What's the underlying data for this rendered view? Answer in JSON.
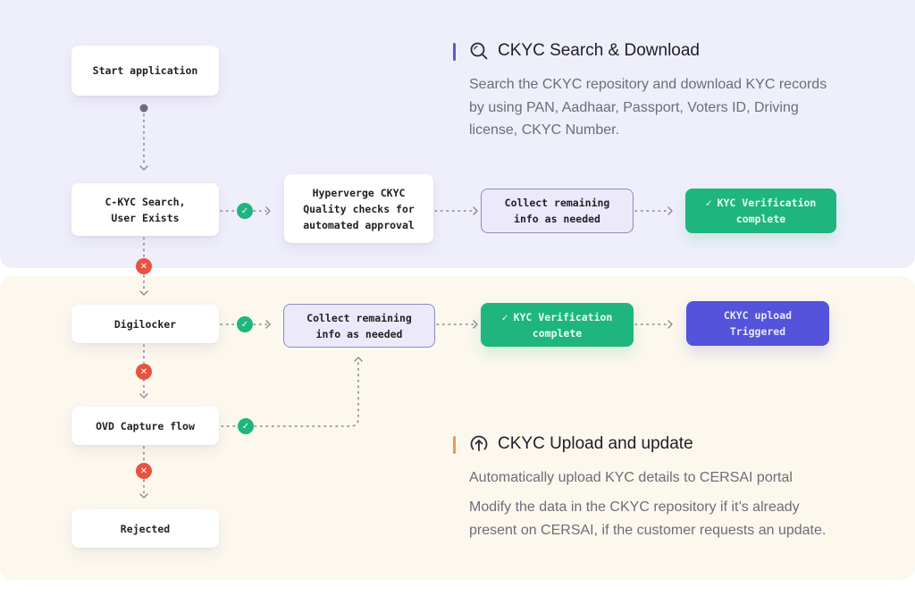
{
  "colors": {
    "top_panel": "#efeffb",
    "bottom_panel": "#fcf8ee",
    "success": "#1fb57f",
    "reject": "#e8533f",
    "triggered": "#5353dc",
    "collect_fill": "#ece9fb",
    "accent_search": "#5b5bc8",
    "accent_upload": "#e59a5c"
  },
  "search_section": {
    "icon": "search-icon",
    "title": "CKYC Search & Download",
    "description": "Search the CKYC repository and download KYC records by using PAN, Aadhaar,  Passport,  Voters ID, Driving license, CKYC Number."
  },
  "upload_section": {
    "icon": "upload-icon",
    "title": "CKYC Upload and update",
    "description_1": "Automatically upload KYC details to CERSAI portal",
    "description_2": "Modify the data in the CKYC repository if it’s already present on CERSAI, if the customer requests an update."
  },
  "flow": {
    "start": "Start application",
    "ckyc_search": [
      "C-KYC Search,",
      "User Exists"
    ],
    "hyperverge": [
      "Hyperverge CKYC",
      "Quality checks for",
      "automated approval"
    ],
    "collect_top": [
      "Collect remaining",
      "info as needed"
    ],
    "verified_top": [
      "KYC Verification",
      "complete"
    ],
    "digilocker": "Digilocker",
    "collect_bottom": [
      "Collect remaining",
      "info as needed"
    ],
    "verified_bottom": [
      "KYC Verification",
      "complete"
    ],
    "upload_triggered": [
      "CKYC upload",
      "Triggered"
    ],
    "ovd": "OVD Capture flow",
    "rejected": "Rejected",
    "success_glyph": "✓",
    "reject_glyph": "✕"
  }
}
